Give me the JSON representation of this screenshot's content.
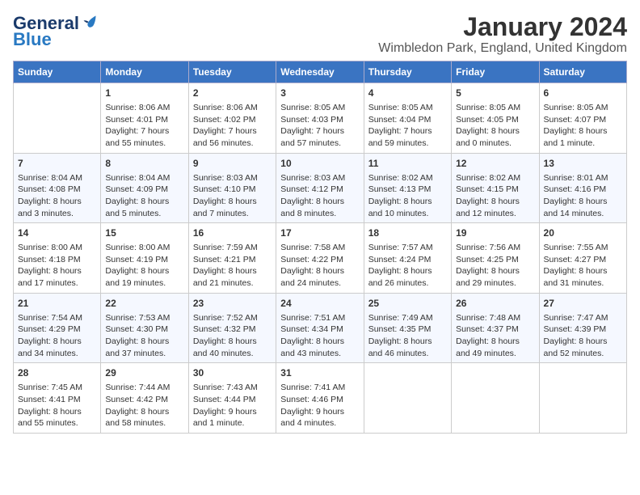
{
  "header": {
    "logo_general": "General",
    "logo_blue": "Blue",
    "title": "January 2024",
    "subtitle": "Wimbledon Park, England, United Kingdom"
  },
  "days_of_week": [
    "Sunday",
    "Monday",
    "Tuesday",
    "Wednesday",
    "Thursday",
    "Friday",
    "Saturday"
  ],
  "weeks": [
    [
      {
        "day": "",
        "info": ""
      },
      {
        "day": "1",
        "info": "Sunrise: 8:06 AM\nSunset: 4:01 PM\nDaylight: 7 hours\nand 55 minutes."
      },
      {
        "day": "2",
        "info": "Sunrise: 8:06 AM\nSunset: 4:02 PM\nDaylight: 7 hours\nand 56 minutes."
      },
      {
        "day": "3",
        "info": "Sunrise: 8:05 AM\nSunset: 4:03 PM\nDaylight: 7 hours\nand 57 minutes."
      },
      {
        "day": "4",
        "info": "Sunrise: 8:05 AM\nSunset: 4:04 PM\nDaylight: 7 hours\nand 59 minutes."
      },
      {
        "day": "5",
        "info": "Sunrise: 8:05 AM\nSunset: 4:05 PM\nDaylight: 8 hours\nand 0 minutes."
      },
      {
        "day": "6",
        "info": "Sunrise: 8:05 AM\nSunset: 4:07 PM\nDaylight: 8 hours\nand 1 minute."
      }
    ],
    [
      {
        "day": "7",
        "info": "Sunrise: 8:04 AM\nSunset: 4:08 PM\nDaylight: 8 hours\nand 3 minutes."
      },
      {
        "day": "8",
        "info": "Sunrise: 8:04 AM\nSunset: 4:09 PM\nDaylight: 8 hours\nand 5 minutes."
      },
      {
        "day": "9",
        "info": "Sunrise: 8:03 AM\nSunset: 4:10 PM\nDaylight: 8 hours\nand 7 minutes."
      },
      {
        "day": "10",
        "info": "Sunrise: 8:03 AM\nSunset: 4:12 PM\nDaylight: 8 hours\nand 8 minutes."
      },
      {
        "day": "11",
        "info": "Sunrise: 8:02 AM\nSunset: 4:13 PM\nDaylight: 8 hours\nand 10 minutes."
      },
      {
        "day": "12",
        "info": "Sunrise: 8:02 AM\nSunset: 4:15 PM\nDaylight: 8 hours\nand 12 minutes."
      },
      {
        "day": "13",
        "info": "Sunrise: 8:01 AM\nSunset: 4:16 PM\nDaylight: 8 hours\nand 14 minutes."
      }
    ],
    [
      {
        "day": "14",
        "info": "Sunrise: 8:00 AM\nSunset: 4:18 PM\nDaylight: 8 hours\nand 17 minutes."
      },
      {
        "day": "15",
        "info": "Sunrise: 8:00 AM\nSunset: 4:19 PM\nDaylight: 8 hours\nand 19 minutes."
      },
      {
        "day": "16",
        "info": "Sunrise: 7:59 AM\nSunset: 4:21 PM\nDaylight: 8 hours\nand 21 minutes."
      },
      {
        "day": "17",
        "info": "Sunrise: 7:58 AM\nSunset: 4:22 PM\nDaylight: 8 hours\nand 24 minutes."
      },
      {
        "day": "18",
        "info": "Sunrise: 7:57 AM\nSunset: 4:24 PM\nDaylight: 8 hours\nand 26 minutes."
      },
      {
        "day": "19",
        "info": "Sunrise: 7:56 AM\nSunset: 4:25 PM\nDaylight: 8 hours\nand 29 minutes."
      },
      {
        "day": "20",
        "info": "Sunrise: 7:55 AM\nSunset: 4:27 PM\nDaylight: 8 hours\nand 31 minutes."
      }
    ],
    [
      {
        "day": "21",
        "info": "Sunrise: 7:54 AM\nSunset: 4:29 PM\nDaylight: 8 hours\nand 34 minutes."
      },
      {
        "day": "22",
        "info": "Sunrise: 7:53 AM\nSunset: 4:30 PM\nDaylight: 8 hours\nand 37 minutes."
      },
      {
        "day": "23",
        "info": "Sunrise: 7:52 AM\nSunset: 4:32 PM\nDaylight: 8 hours\nand 40 minutes."
      },
      {
        "day": "24",
        "info": "Sunrise: 7:51 AM\nSunset: 4:34 PM\nDaylight: 8 hours\nand 43 minutes."
      },
      {
        "day": "25",
        "info": "Sunrise: 7:49 AM\nSunset: 4:35 PM\nDaylight: 8 hours\nand 46 minutes."
      },
      {
        "day": "26",
        "info": "Sunrise: 7:48 AM\nSunset: 4:37 PM\nDaylight: 8 hours\nand 49 minutes."
      },
      {
        "day": "27",
        "info": "Sunrise: 7:47 AM\nSunset: 4:39 PM\nDaylight: 8 hours\nand 52 minutes."
      }
    ],
    [
      {
        "day": "28",
        "info": "Sunrise: 7:45 AM\nSunset: 4:41 PM\nDaylight: 8 hours\nand 55 minutes."
      },
      {
        "day": "29",
        "info": "Sunrise: 7:44 AM\nSunset: 4:42 PM\nDaylight: 8 hours\nand 58 minutes."
      },
      {
        "day": "30",
        "info": "Sunrise: 7:43 AM\nSunset: 4:44 PM\nDaylight: 9 hours\nand 1 minute."
      },
      {
        "day": "31",
        "info": "Sunrise: 7:41 AM\nSunset: 4:46 PM\nDaylight: 9 hours\nand 4 minutes."
      },
      {
        "day": "",
        "info": ""
      },
      {
        "day": "",
        "info": ""
      },
      {
        "day": "",
        "info": ""
      }
    ]
  ]
}
